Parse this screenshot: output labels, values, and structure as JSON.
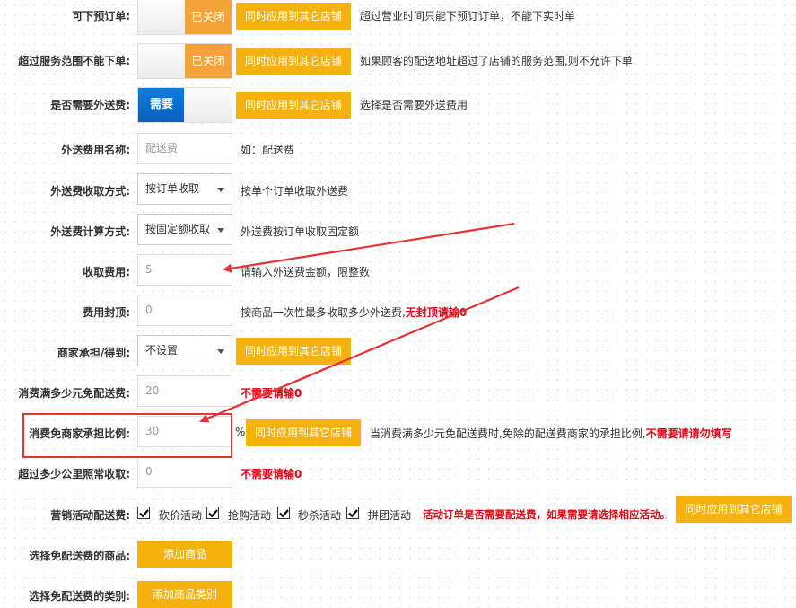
{
  "apply_label": "同时应用到其它店铺",
  "rows": {
    "preorder": {
      "label": "可下预订单:",
      "toggle": "已关闭",
      "help": "超过营业时间只能下预订订单，不能下实时单"
    },
    "out_of_range": {
      "label": "超过服务范围不能下单:",
      "toggle": "已关闭",
      "help": "如果顾客的配送地址超过了店铺的服务范围,则不允许下单"
    },
    "need_fee": {
      "label": "是否需要外送费:",
      "toggle": "需要",
      "help": "选择是否需要外送费用"
    },
    "fee_name": {
      "label": "外送费用名称:",
      "placeholder": "配送费",
      "help": "如：配送费"
    },
    "charge_mode": {
      "label": "外送费收取方式:",
      "value": "按订单收取",
      "help": "按单个订单收取外送费"
    },
    "calc_mode": {
      "label": "外送费计算方式:",
      "value": "按固定额收取",
      "help": "外送费按订单收取固定额"
    },
    "fee_amount": {
      "label": "收取费用:",
      "value": "5",
      "help": "请输入外送费金额，限整数"
    },
    "fee_cap": {
      "label": "费用封顶:",
      "value": "0",
      "help": "按商品一次性最多收取多少外送费,",
      "warn": "无封顶请输0"
    },
    "merchant_bear": {
      "label": "商家承担/得到:",
      "value": "不设置"
    },
    "free_threshold": {
      "label": "消费满多少元免配送费:",
      "value": "20",
      "warn": "不需要请输0"
    },
    "free_ratio": {
      "label": "消费免商家承担比例:",
      "value": "30",
      "unit": "%",
      "help": "当消费满多少元免配送费时,免除的配送费商家的承担比例,",
      "warn": "不需要请请勿填写"
    },
    "distance": {
      "label": "超过多少公里照常收取:",
      "value": "0",
      "warn": "不需要请输0"
    },
    "promo": {
      "label": "营销活动配送费:",
      "options": [
        "砍价活动",
        "抢购活动",
        "秒杀活动",
        "拼团活动"
      ],
      "warn": "活动订单是否需要配送费，如果需要请选择相应活动。"
    },
    "free_goods": {
      "label": "选择免配送费的商品:",
      "button": "添加商品"
    },
    "free_category": {
      "label": "选择免配送费的类别:",
      "button": "添加商品类别"
    }
  },
  "colors": {
    "accent": "#f5b20e",
    "toggle_off": "#f3a33a",
    "toggle_on": "#0a6fd0",
    "warn": "#e60012",
    "annotation": "#e53333"
  }
}
